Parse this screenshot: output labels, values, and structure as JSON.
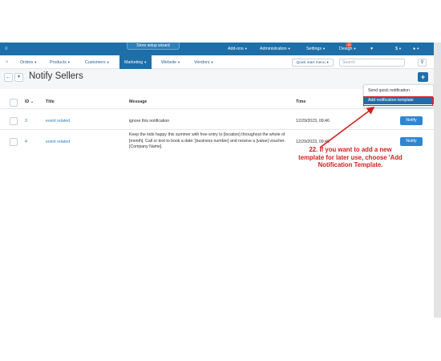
{
  "topbar": {
    "wizard": "Store setup wizard",
    "menus": [
      "Add-ons",
      "Administration",
      "Settings",
      "Design"
    ],
    "notification_count": "10",
    "currency": "$"
  },
  "nav": {
    "items": [
      "Orders",
      "Products",
      "Customers",
      "Marketing",
      "Website",
      "Vendors"
    ],
    "active": "Marketing",
    "quick_start": "Quick start menu",
    "search_placeholder": "Search"
  },
  "page": {
    "title": "Notify Sellers"
  },
  "dropdown": {
    "items": [
      "Send quick notification",
      "Add notification template"
    ],
    "highlighted": "Add notification template"
  },
  "table": {
    "headers": {
      "id": "ID",
      "title": "Title",
      "message": "Message",
      "time": "Time"
    },
    "rows": [
      {
        "id": "3",
        "title": "event related",
        "message": "ignore this notification",
        "time": "12/29/2023, 09:46",
        "action": "Notify"
      },
      {
        "id": "4",
        "title": "event related",
        "message": "Keep the kids happy this summer with free entry to [location] throughout the whole of [month]. Call or text to book a date: [business number] and receive a [value] voucher. [Company Name].",
        "time": "12/29/2023, 09:46",
        "action": "Notify"
      }
    ]
  },
  "annotation": {
    "text": "22. If you want to add a new template for later use, choose 'Add Notification Template.",
    "color": "#d81c1c"
  },
  "colors": {
    "brand": "#1e6fa8",
    "link": "#2b7fc1",
    "button": "#2f86d0"
  }
}
